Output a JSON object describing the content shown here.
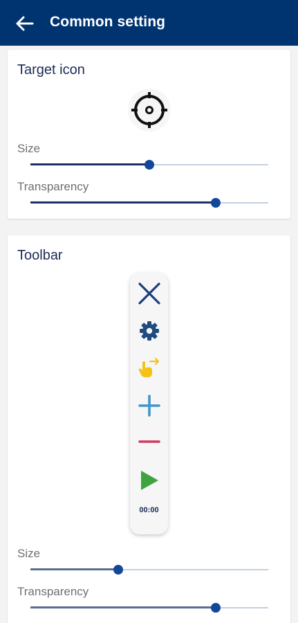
{
  "header": {
    "title": "Common setting"
  },
  "target_card": {
    "title": "Target icon",
    "size_label": "Size",
    "size_value": 0.5,
    "transparency_label": "Transparency",
    "transparency_value": 0.78
  },
  "toolbar_card": {
    "title": "Toolbar",
    "timer_text": "00:00",
    "buttons": [
      "close-icon",
      "gear-icon",
      "swipe-hand-icon",
      "plus-icon",
      "minus-icon",
      "play-icon"
    ],
    "size_label": "Size",
    "size_value": 0.37,
    "transparency_label": "Transparency",
    "transparency_value": 0.78
  },
  "colors": {
    "header_bg": "#003471",
    "accent": "#12479a",
    "close": "#1a3d7c",
    "gear": "#1f4b80",
    "swipe": "#f3c316",
    "plus": "#3f96c9",
    "minus": "#d23960",
    "play": "#3fa43f"
  }
}
